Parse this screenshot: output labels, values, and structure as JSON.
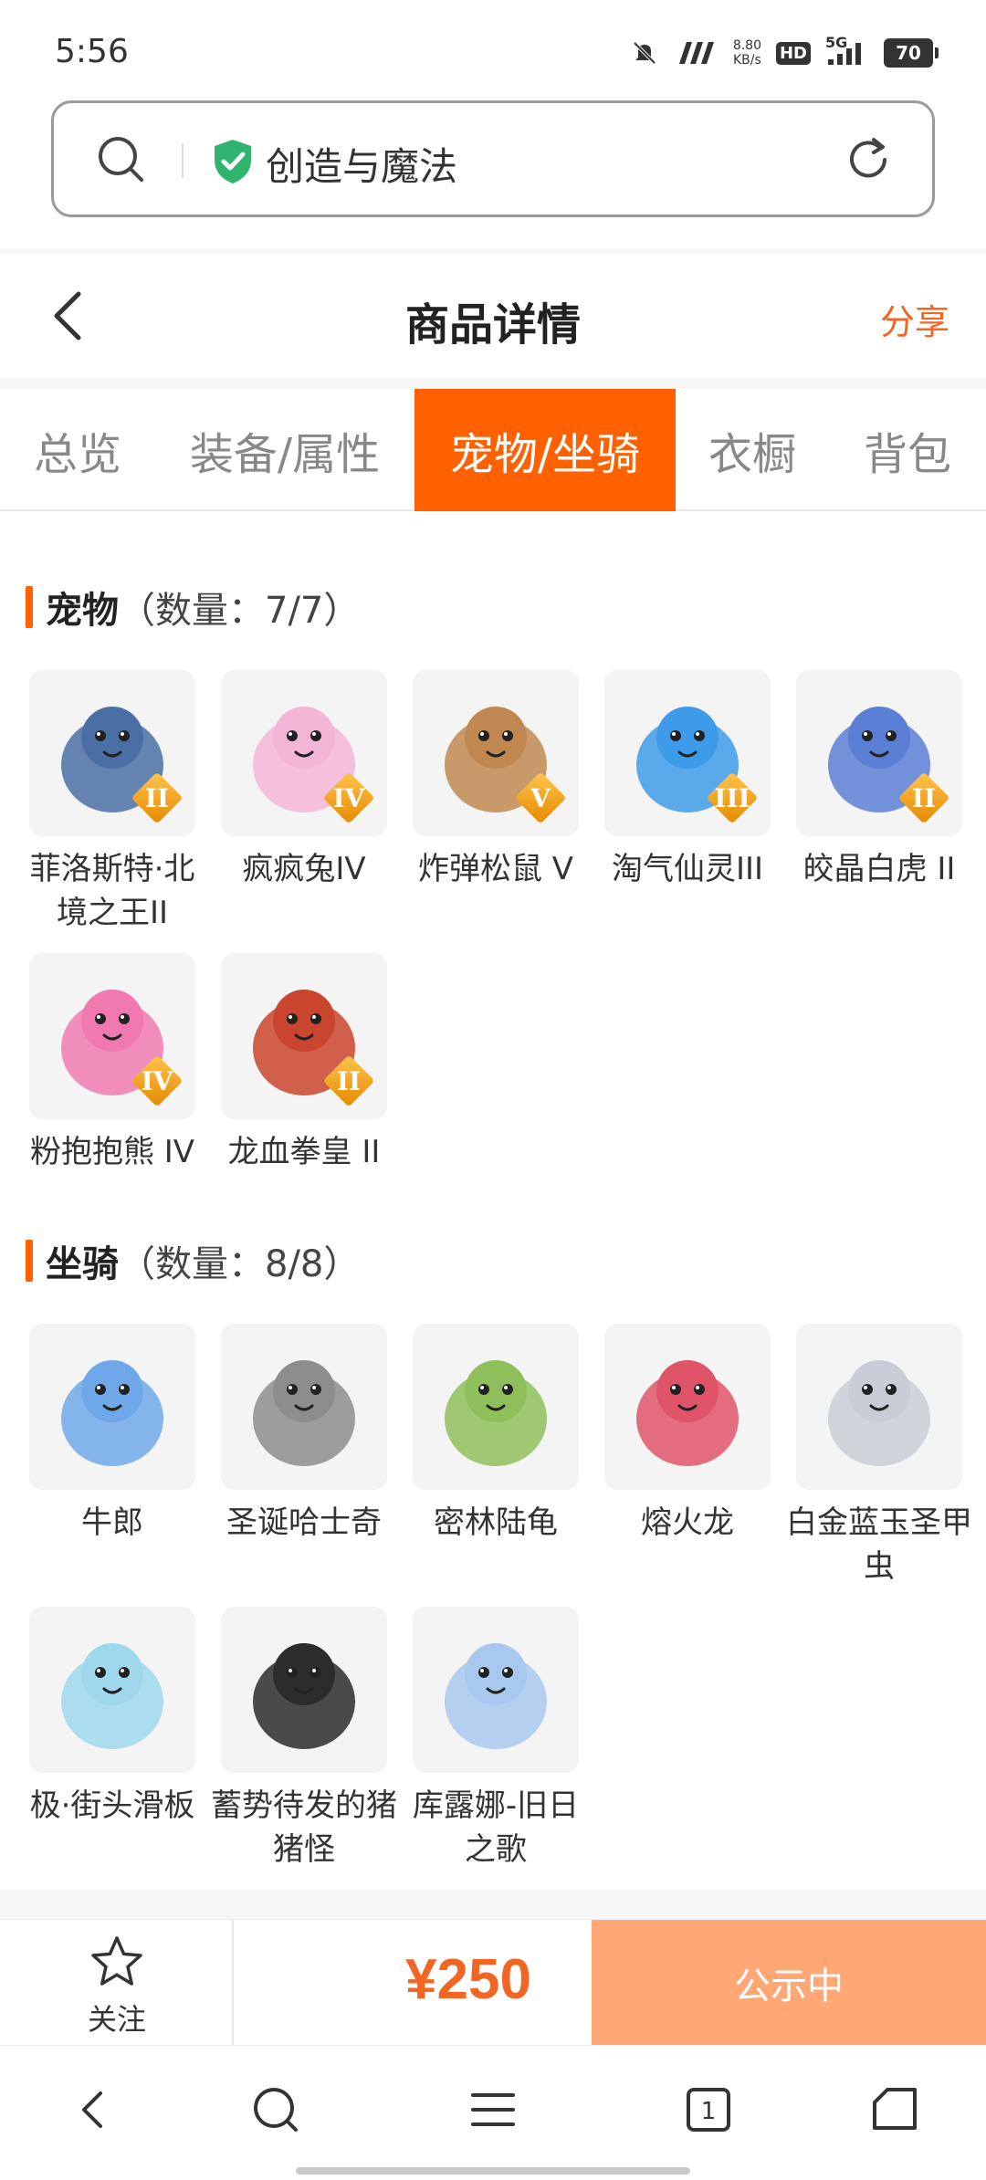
{
  "status_bar": {
    "time": "5:56",
    "net_speed_value": "8.80",
    "net_speed_unit": "KB/s",
    "hd": "HD",
    "signal": "5G",
    "battery": "70"
  },
  "browser": {
    "url_text": "创造与魔法"
  },
  "header": {
    "title": "商品详情",
    "share": "分享"
  },
  "tabs": [
    {
      "label": "总览",
      "active": false
    },
    {
      "label": "装备/属性",
      "active": false
    },
    {
      "label": "宠物/坐骑",
      "active": true
    },
    {
      "label": "衣橱",
      "active": false
    },
    {
      "label": "背包",
      "active": false
    }
  ],
  "pets": {
    "title": "宠物",
    "count": "（数量：7/7）",
    "items": [
      {
        "name": "菲洛斯特·北境之王II",
        "tier": "II",
        "icon": "frost-dragon-knight",
        "color": "#4a6fa5"
      },
      {
        "name": "疯疯兔IV",
        "tier": "IV",
        "icon": "crazy-rabbit",
        "color": "#f3b6d6"
      },
      {
        "name": "炸弹松鼠 V",
        "tier": "V",
        "icon": "bomb-squirrel",
        "color": "#c08850"
      },
      {
        "name": "淘气仙灵III",
        "tier": "III",
        "icon": "naughty-fairy",
        "color": "#3d9be9"
      },
      {
        "name": "皎晶白虎 II",
        "tier": "II",
        "icon": "crystal-white-tiger",
        "color": "#5c7fd6"
      },
      {
        "name": "粉抱抱熊 IV",
        "tier": "IV",
        "icon": "pink-hug-bear",
        "color": "#f07ab0"
      },
      {
        "name": "龙血拳皇 II",
        "tier": "II",
        "icon": "dragonblood-fist-king",
        "color": "#c9452e"
      }
    ]
  },
  "mounts": {
    "title": "坐骑",
    "count": "（数量：8/8）",
    "items": [
      {
        "name": "牛郎",
        "icon": "cowherd",
        "color": "#6fa8e8"
      },
      {
        "name": "圣诞哈士奇",
        "icon": "christmas-husky",
        "color": "#8d8d8d"
      },
      {
        "name": "密林陆龟",
        "icon": "jungle-tortoise",
        "color": "#8fbf5a"
      },
      {
        "name": "熔火龙",
        "icon": "magma-dragon",
        "color": "#e0546a"
      },
      {
        "name": "白金蓝玉圣甲虫",
        "icon": "platinum-scarab",
        "color": "#c9ced6"
      },
      {
        "name": "极·街头滑板",
        "icon": "street-skateboard",
        "color": "#9fd8ec"
      },
      {
        "name": "蓄势待发的猪猪怪",
        "icon": "ready-pig-monster",
        "color": "#2c2c2c"
      },
      {
        "name": "库露娜-旧日之歌",
        "icon": "kuluna-old-song",
        "color": "#a9c8ef"
      }
    ]
  },
  "action_bar": {
    "follow_label": "关注",
    "price": "¥250",
    "status_button": "公示中"
  },
  "colors": {
    "accent": "#ff6000",
    "price": "#f26522",
    "status_button_bg": "#ffa775"
  }
}
